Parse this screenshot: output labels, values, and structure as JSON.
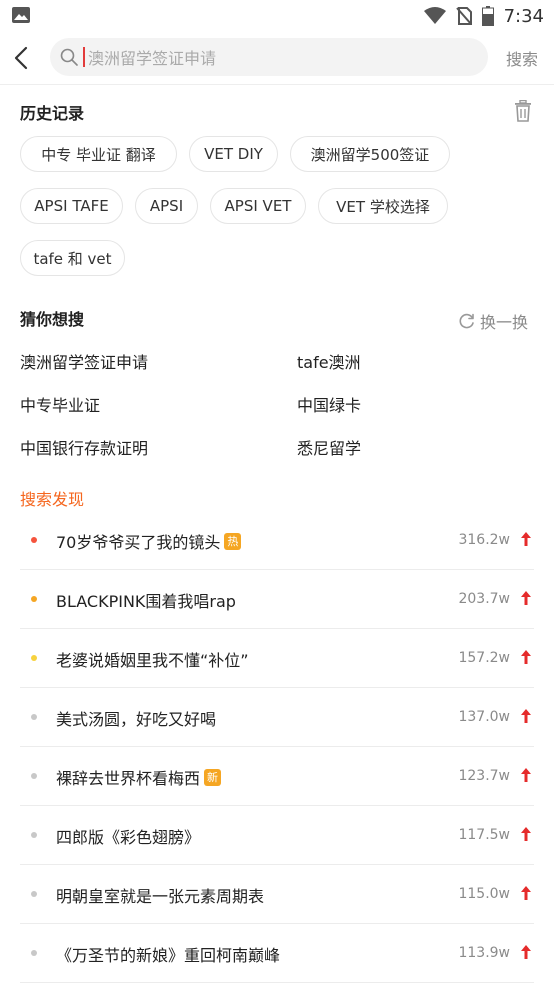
{
  "status_bar": {
    "time": "7:34",
    "icons": [
      "image-icon",
      "wifi-icon",
      "no-sim-icon",
      "battery-icon"
    ]
  },
  "search": {
    "placeholder": "澳洲留学签证申请",
    "button_label": "搜索"
  },
  "history": {
    "title": "历史记录",
    "chips": [
      "中专 毕业证 翻译",
      "VET DIY",
      "澳洲留学500签证",
      "APSI TAFE",
      "APSI",
      "APSI VET",
      "VET 学校选择",
      "tafe 和 vet"
    ]
  },
  "guess": {
    "title": "猜你想搜",
    "refresh_label": "换一换",
    "items": [
      "澳洲留学签证申请",
      "tafe澳洲",
      "中专毕业证",
      "中国绿卡",
      "中国银行存款证明",
      "悉尼留学"
    ]
  },
  "discover": {
    "title": "搜索发现",
    "items": [
      {
        "title": "70岁爷爷买了我的镜头",
        "count": "316.2w",
        "badge": "热",
        "badge_color": "#f5a623",
        "dot_color": "#f5533d"
      },
      {
        "title": "BLACKPINK围着我唱rap",
        "count": "203.7w",
        "badge": "",
        "badge_color": "",
        "dot_color": "#f5a623"
      },
      {
        "title": "老婆说婚姻里我不懂“补位”",
        "count": "157.2w",
        "badge": "",
        "badge_color": "",
        "dot_color": "#f7d23e"
      },
      {
        "title": "美式汤圆，好吃又好喝",
        "count": "137.0w",
        "badge": "",
        "badge_color": "",
        "dot_color": "#c8c8c8"
      },
      {
        "title": "裸辞去世界杯看梅西",
        "count": "123.7w",
        "badge": "新",
        "badge_color": "#f5a623",
        "dot_color": "#c8c8c8"
      },
      {
        "title": "四郎版《彩色翅膀》",
        "count": "117.5w",
        "badge": "",
        "badge_color": "",
        "dot_color": "#c8c8c8"
      },
      {
        "title": "明朝皇室就是一张元素周期表",
        "count": "115.0w",
        "badge": "",
        "badge_color": "",
        "dot_color": "#c8c8c8"
      },
      {
        "title": "《万圣节的新娘》重回柯南巅峰",
        "count": "113.9w",
        "badge": "",
        "badge_color": "",
        "dot_color": "#c8c8c8"
      }
    ],
    "arrow_color": "#e52b2b"
  }
}
